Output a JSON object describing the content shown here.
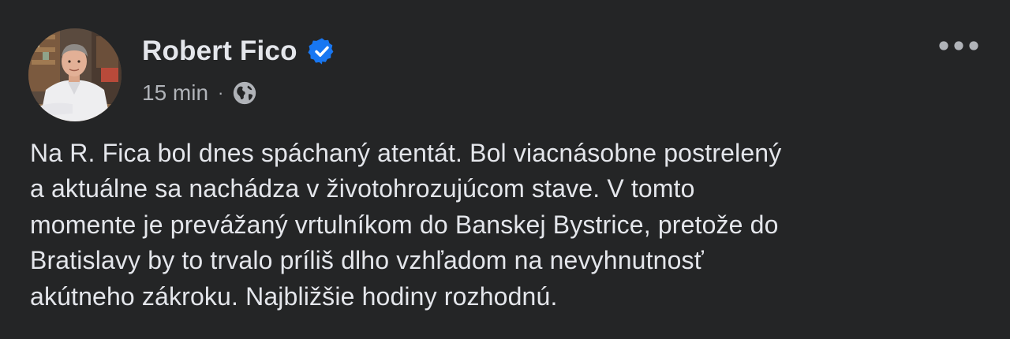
{
  "post": {
    "author": {
      "name": "Robert Fico",
      "verified": true,
      "verified_badge_color": "#1877f2",
      "avatar_icon": "profile-photo"
    },
    "meta": {
      "time": "15 min",
      "separator": "·",
      "audience_icon": "globe-icon"
    },
    "more_icon": "more-options-icon",
    "text": "Na R. Fica bol dnes spáchaný atentát. Bol viacnásobne postrelený\na aktuálne sa nachádza v životohrozujúcom stave. V tomto\nmomente je prevážaný vrtulníkom do Banskej Bystrice, pretože do\nBratislavy by to trvalo príliš dlho vzhľadom na nevyhnutnosť\nakútneho zákroku. Najbližšie hodiny rozhodnú."
  },
  "colors": {
    "background": "#242526",
    "primary_text": "#e4e6eb",
    "secondary_text": "#b0b3b8",
    "accent": "#1877f2"
  }
}
